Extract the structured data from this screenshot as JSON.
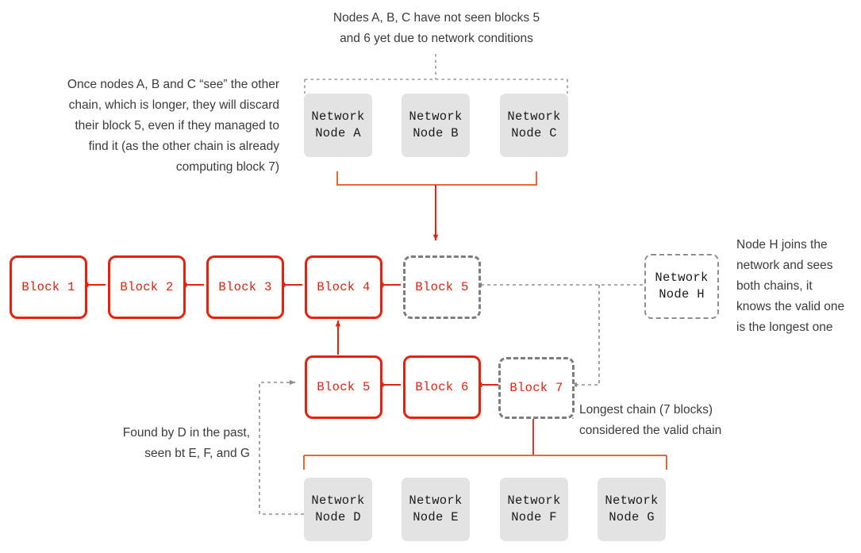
{
  "colors": {
    "block_red": "#e8200c",
    "bracket_orange": "#ef6636",
    "node_gray_fill": "#e3e3e3",
    "dashed_gray": "#8d8d8d",
    "text_gray": "#3b3b3b",
    "background": "#ffffff"
  },
  "annotations": {
    "top_note": "Nodes A, B, C have not seen blocks 5\nand 6 yet due to network conditions",
    "left_note": "Once nodes A, B and C “see” the other\nchain, which is longer, they will discard\ntheir block 5, even if they managed to\nfind it (as the other chain is already\ncomputing block 7)",
    "node_h_note": "Node H joins the\nnetwork and sees\nboth chains, it\nknows the valid one\nis the longest one",
    "longest_chain_note": "Longest chain (7 blocks)\nconsidered the valid chain",
    "found_by_d_note": "Found by D in the past,\nseen bt E, F, and G"
  },
  "top_nodes": [
    {
      "label": "Network\nNode A"
    },
    {
      "label": "Network\nNode B"
    },
    {
      "label": "Network\nNode C"
    }
  ],
  "bottom_nodes": [
    {
      "label": "Network\nNode D"
    },
    {
      "label": "Network\nNode E"
    },
    {
      "label": "Network\nNode F"
    },
    {
      "label": "Network\nNode G"
    }
  ],
  "joining_node": {
    "label": "Network\nNode  H"
  },
  "main_chain": [
    {
      "label": "Block 1",
      "state": "confirmed"
    },
    {
      "label": "Block 2",
      "state": "confirmed"
    },
    {
      "label": "Block 3",
      "state": "confirmed"
    },
    {
      "label": "Block 4",
      "state": "confirmed"
    }
  ],
  "orphan_chain": [
    {
      "label": "Block 5",
      "state": "orphaned"
    }
  ],
  "longest_chain": [
    {
      "label": "Block 5",
      "state": "confirmed"
    },
    {
      "label": "Block 6",
      "state": "confirmed"
    },
    {
      "label": "Block 7",
      "state": "pending"
    }
  ]
}
